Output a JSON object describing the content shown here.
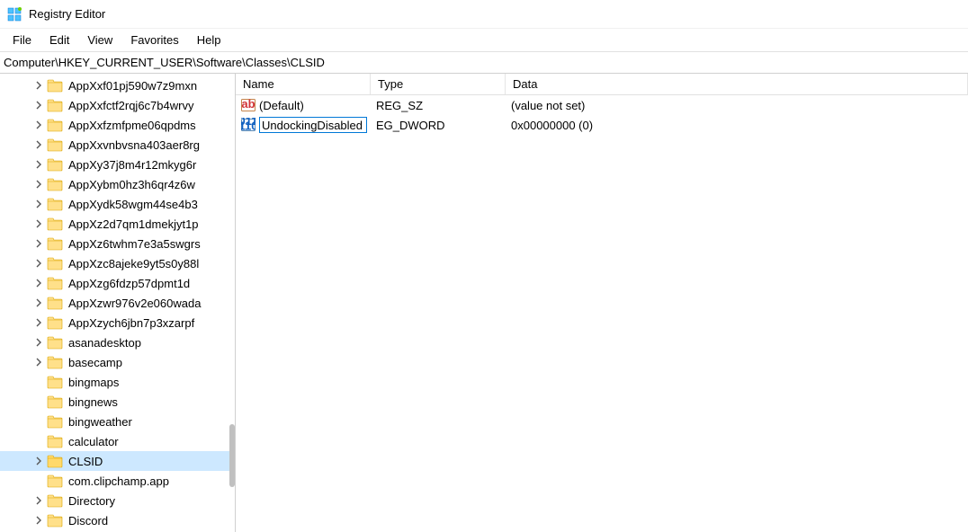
{
  "title": "Registry Editor",
  "menus": [
    "File",
    "Edit",
    "View",
    "Favorites",
    "Help"
  ],
  "address": "Computer\\HKEY_CURRENT_USER\\Software\\Classes\\CLSID",
  "tree": [
    {
      "label": "AppXxf01pj590w7z9mxn",
      "exp": true
    },
    {
      "label": "AppXxfctf2rqj6c7b4wrvy",
      "exp": true
    },
    {
      "label": "AppXxfzmfpme06qpdms",
      "exp": true
    },
    {
      "label": "AppXxvnbvsna403aer8rg",
      "exp": true
    },
    {
      "label": "AppXy37j8m4r12mkyg6r",
      "exp": true
    },
    {
      "label": "AppXybm0hz3h6qr4z6w",
      "exp": true
    },
    {
      "label": "AppXydk58wgm44se4b3",
      "exp": true
    },
    {
      "label": "AppXz2d7qm1dmekjyt1p",
      "exp": true
    },
    {
      "label": "AppXz6twhm7e3a5swgrs",
      "exp": true
    },
    {
      "label": "AppXzc8ajeke9yt5s0y88l",
      "exp": true
    },
    {
      "label": "AppXzg6fdzp57dpmt1d",
      "exp": true
    },
    {
      "label": "AppXzwr976v2e060wada",
      "exp": true
    },
    {
      "label": "AppXzych6jbn7p3xzarpf",
      "exp": true
    },
    {
      "label": "asanadesktop",
      "exp": true
    },
    {
      "label": "basecamp",
      "exp": true
    },
    {
      "label": "bingmaps",
      "exp": false
    },
    {
      "label": "bingnews",
      "exp": false
    },
    {
      "label": "bingweather",
      "exp": false
    },
    {
      "label": "calculator",
      "exp": false
    },
    {
      "label": "CLSID",
      "exp": true,
      "selected": true
    },
    {
      "label": "com.clipchamp.app",
      "exp": false
    },
    {
      "label": "Directory",
      "exp": true
    },
    {
      "label": "Discord",
      "exp": true
    }
  ],
  "columns": {
    "name": "Name",
    "type": "Type",
    "data": "Data"
  },
  "values": [
    {
      "name": "(Default)",
      "type": "REG_SZ",
      "data": "(value not set)",
      "icon": "string"
    },
    {
      "name": "UndockingDisabled",
      "type": "REG_DWORD",
      "data": "0x00000000 (0)",
      "icon": "binary",
      "editing": true,
      "truncated_type": "EG_DWORD"
    }
  ]
}
